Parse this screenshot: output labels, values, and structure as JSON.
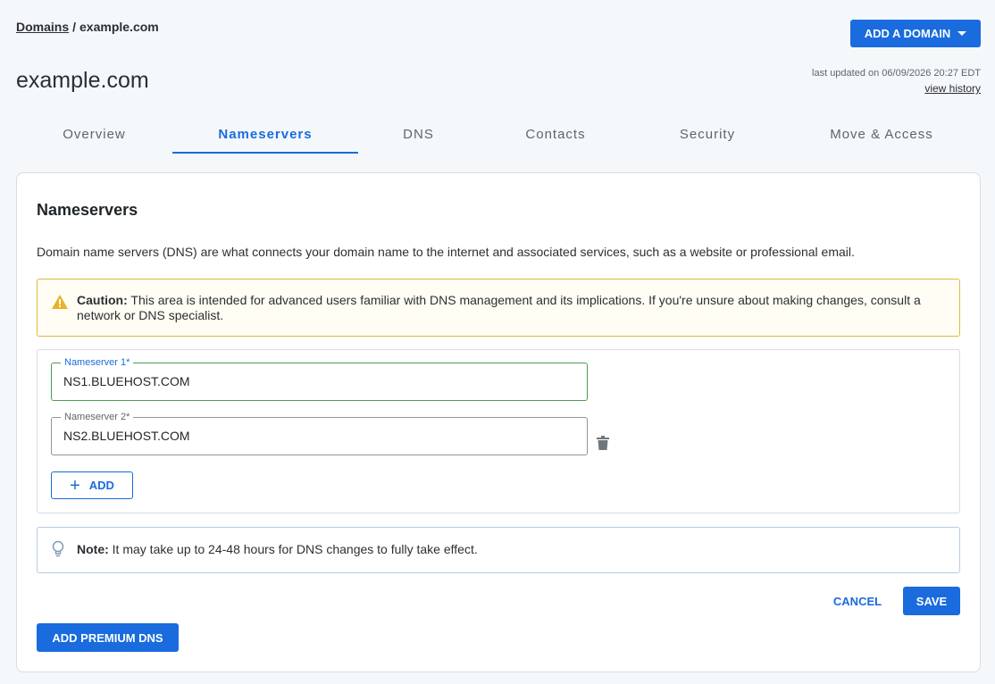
{
  "breadcrumb": {
    "root": "Domains",
    "separator": "/",
    "current": "example.com"
  },
  "header": {
    "add_domain_label": "ADD A DOMAIN",
    "domain_title": "example.com",
    "last_updated": "last updated on 06/09/2026 20:27 EDT",
    "view_history": "view history"
  },
  "tabs": [
    {
      "label": "Overview",
      "active": false
    },
    {
      "label": "Nameservers",
      "active": true
    },
    {
      "label": "DNS",
      "active": false
    },
    {
      "label": "Contacts",
      "active": false
    },
    {
      "label": "Security",
      "active": false
    },
    {
      "label": "Move & Access",
      "active": false
    }
  ],
  "card": {
    "title": "Nameservers",
    "description": "Domain name servers (DNS) are what connects your domain name to the internet and associated services, such as a website or professional email.",
    "caution_label": "Caution:",
    "caution_text": " This area is intended for advanced users familiar with DNS management and its implications. If you're unsure about making changes, consult a network or DNS specialist.",
    "nameservers": [
      {
        "label": "Nameserver 1*",
        "value": "NS1.BLUEHOST.COM"
      },
      {
        "label": "Nameserver 2*",
        "value": "NS2.BLUEHOST.COM"
      }
    ],
    "add_label": "ADD",
    "note_label": "Note:",
    "note_text": " It may take up to 24-48 hours for DNS changes to fully take effect.",
    "cancel_label": "CANCEL",
    "save_label": "SAVE",
    "premium_label": "ADD PREMIUM DNS"
  },
  "icons": {
    "warning": "warning-icon",
    "trash": "trash-icon",
    "plus": "plus-icon",
    "bulb": "lightbulb-icon",
    "caret": "caret-down-icon"
  },
  "colors": {
    "primary": "#196bde",
    "caution_border": "#e0b93f",
    "caution_icon": "#e8b22a",
    "note_border": "#b7cde3",
    "focus_border": "#4f9c52"
  }
}
